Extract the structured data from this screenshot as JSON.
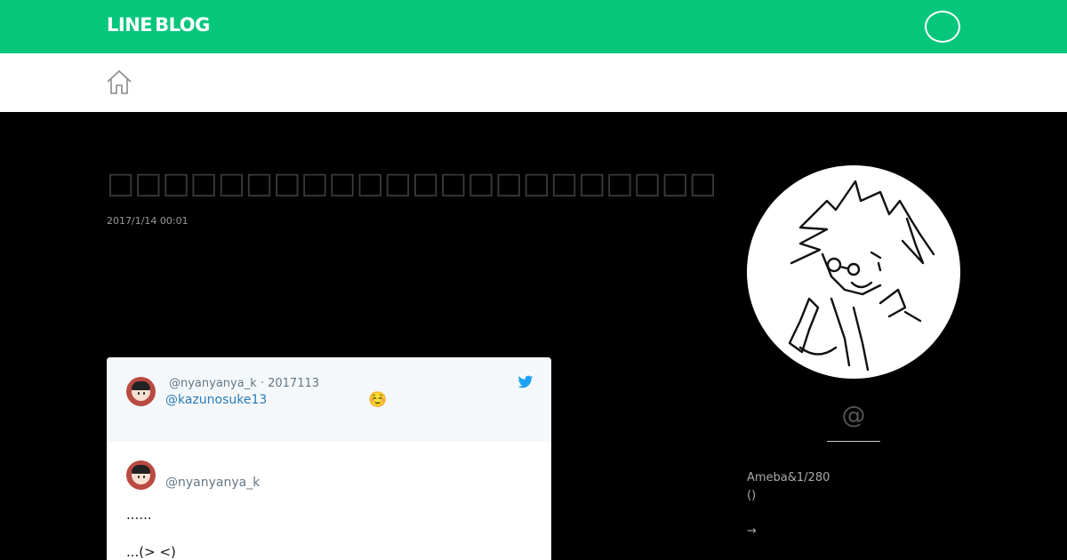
{
  "header": {
    "logo_left": "LINE",
    "logo_right": "BLOG",
    "brand_color": "#06c67c"
  },
  "nav": {
    "home_icon": "home-icon"
  },
  "article": {
    "title": "□□□□□□□□□□□□□□□□□□□□□□",
    "date": "2017/1/14 00:01"
  },
  "tweet": {
    "reply_meta": "@nyanyanya_k · 2017113",
    "reply_mention": "@kazunosuke13",
    "reply_emoji": "☺️",
    "handle": "@nyanyanya_k",
    "line1": "......",
    "line2": "...(> <)",
    "icon": "twitter-icon"
  },
  "profile": {
    "name": "@",
    "desc1": "Ameba&1/280",
    "desc2": "()",
    "more": "→"
  }
}
